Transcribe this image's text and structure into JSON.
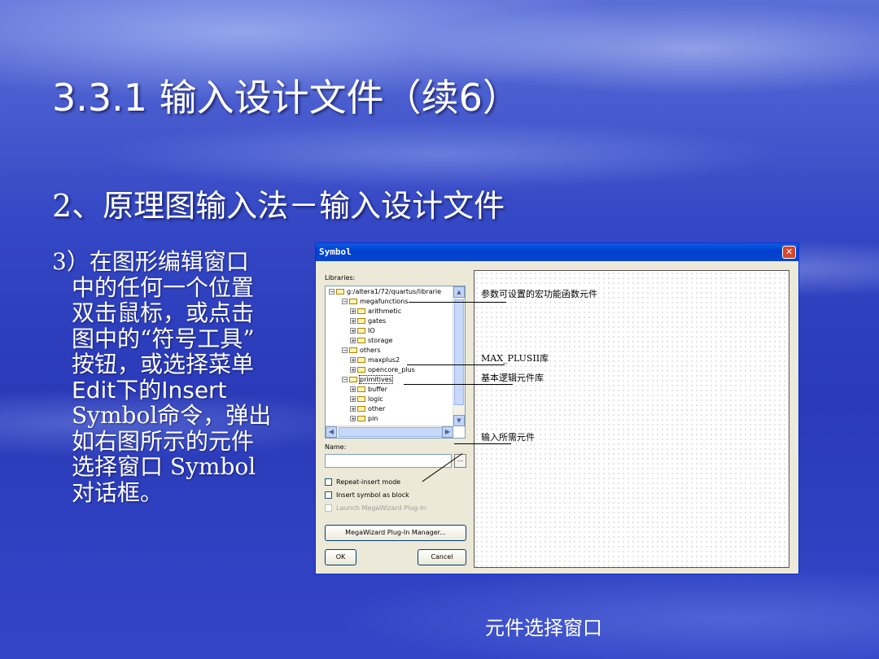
{
  "slide": {
    "title": "3.3.1 输入设计文件（续6）",
    "subtitle": "2、原理图输入法－输入设计文件",
    "body_lines": [
      "3）在图形编辑窗口",
      "中的任何一个位置",
      "双击鼠标，或点击",
      "图中的“符号工具”",
      "按钮，或选择菜单",
      "Edit下的Insert",
      "Symbol命令，弹出",
      "如右图所示的元件",
      "选择窗口 Symbol",
      "对话框。"
    ],
    "caption": "元件选择窗口"
  },
  "dialog": {
    "title": "Symbol",
    "libraries_label": "Libraries:",
    "tree": [
      {
        "label": "g:/altera1/72/quartus/librarie",
        "expander": "⊟",
        "level": 0
      },
      {
        "label": "megafunctions",
        "expander": "⊟",
        "level": 1
      },
      {
        "label": "arithmetic",
        "expander": "⊞",
        "level": 2
      },
      {
        "label": "gates",
        "expander": "⊞",
        "level": 2
      },
      {
        "label": "IO",
        "expander": "⊞",
        "level": 2
      },
      {
        "label": "storage",
        "expander": "⊞",
        "level": 2
      },
      {
        "label": "others",
        "expander": "⊟",
        "level": 1
      },
      {
        "label": "maxplus2",
        "expander": "⊞",
        "level": 2
      },
      {
        "label": "opencore_plus",
        "expander": "⊞",
        "level": 2
      },
      {
        "label": "primitives",
        "expander": "⊟",
        "level": 1
      },
      {
        "label": "buffer",
        "expander": "⊞",
        "level": 2
      },
      {
        "label": "logic",
        "expander": "⊞",
        "level": 2
      },
      {
        "label": "other",
        "expander": "⊞",
        "level": 2
      },
      {
        "label": "pin",
        "expander": "⊞",
        "level": 2
      }
    ],
    "name_label": "Name:",
    "name_value": "",
    "browse_label": "...",
    "checkboxes": [
      {
        "label": "Repeat-insert mode",
        "checked": false,
        "enabled": true
      },
      {
        "label": "Insert symbol as block",
        "checked": false,
        "enabled": true
      },
      {
        "label": "Launch MegaWizard Plug-In",
        "checked": false,
        "enabled": false
      }
    ],
    "megawizard_button": "MegaWizard Plug-In Manager...",
    "ok_button": "OK",
    "cancel_button": "Cancel",
    "annotations": {
      "megafunctions": "参数可设置的宏功能函数元件",
      "maxplus2": "MAX_PLUSII库",
      "primitives": "基本逻辑元件库",
      "name": "输入所需元件"
    }
  }
}
